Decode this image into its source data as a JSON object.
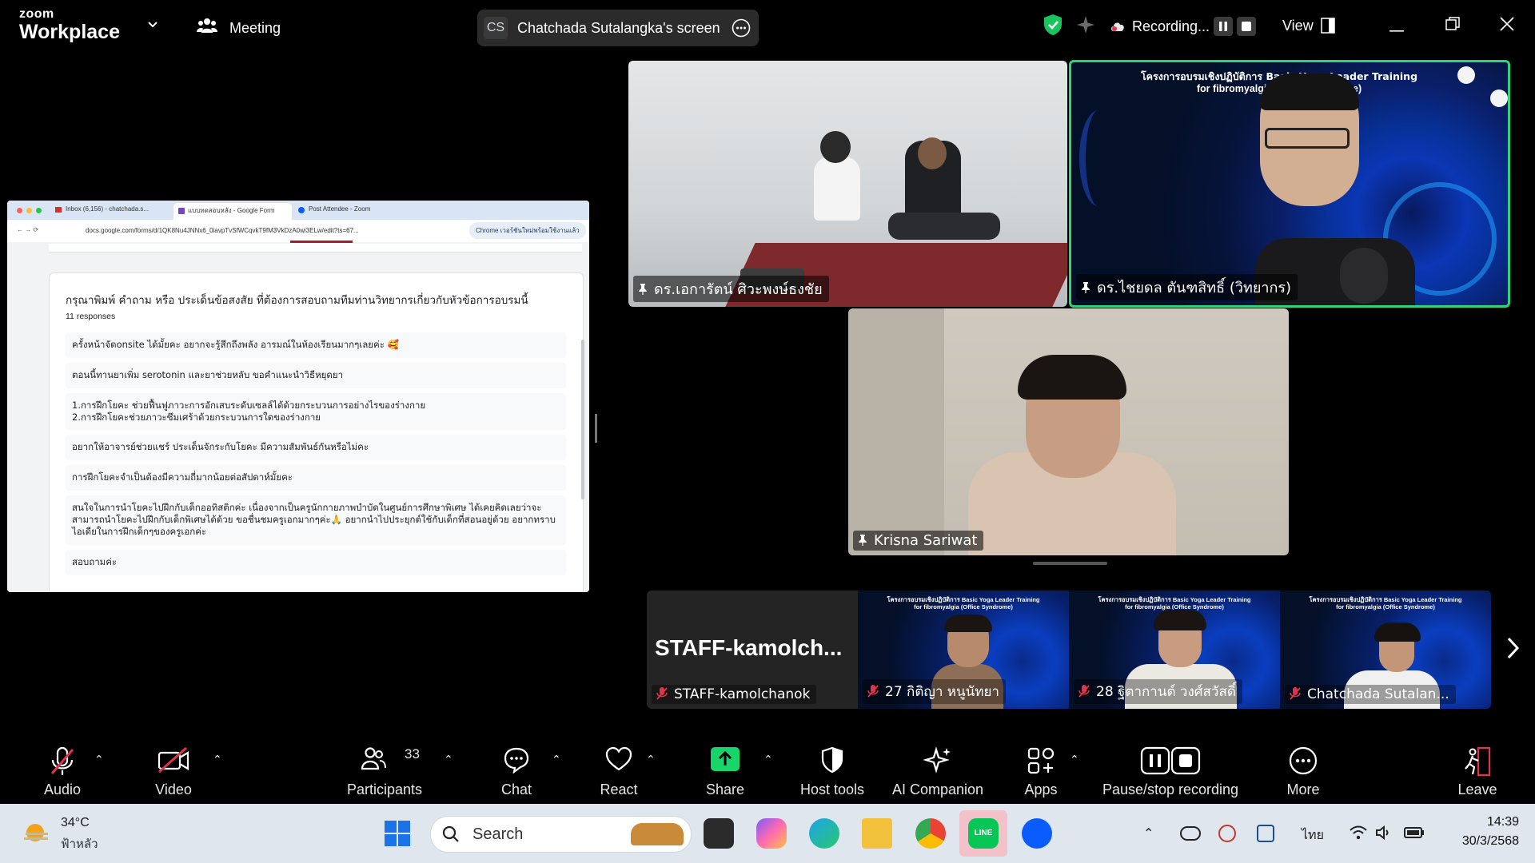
{
  "topbar": {
    "logo_small": "zoom",
    "logo_big": "Workplace",
    "meeting_label": "Meeting",
    "share_badge": "CS",
    "share_title": "Chatchada Sutalangka's screen",
    "recording_label": "Recording...",
    "view_label": "View"
  },
  "shared_screen": {
    "tabs": [
      "Inbox (6,156) - chatchada.s...",
      "แบบทดสอบหลัง - Google Form",
      "Post Attendee - Zoom"
    ],
    "url": "docs.google.com/forms/d/1QK8Nu4JNNx6_0iavpTvSfWCqvkT9fM3VkDzA0wi3ELw/edit?ts=67...",
    "chrome_update": "Chrome เวอร์ชันใหม่พร้อมใช้งานแล้ว",
    "question": "กรุณาพิมพ์ คำถาม หรือ ประเด็นข้อสงสัย ที่ต้องการสอบถามทีมท่านวิทยากรเกี่ยวกับหัวข้อการอบรมนี้",
    "response_count": "11 responses",
    "responses": [
      "ครั้งหน้าจัดonsite ได้มั้ยคะ อยากจะรู้สึกถึงพลัง อารมณ์ในห้องเรียนมากๆเลยค่ะ 🥰",
      "ตอนนี้ทานยาเพิ่ม serotonin และยาช่วยหลับ ขอคำแนะนำวิธีหยุดยา",
      "1.การฝึกโยคะ ช่วยฟื้นฟูภาวะการอักเสบระดับเซลล์ได้ด้วยกระบวนการอย่างไรของร่างกาย\n2.การฝึกโยคะช่วยภาวะซึมเศร้าด้วยกระบวนการใดของร่างกาย",
      "อยากให้อาจารย์ช่วยแชร์ ประเด็นจักระกับโยคะ มีความสัมพันธ์กันหรือไม่คะ",
      "การฝึกโยคะจำเป็นต้องมีความถี่มากน้อยต่อสัปดาห์มั้ยคะ",
      "สนใจในการนำโยคะไปฝึกกับเด็กออทิสติกค่ะ เนื่องจากเป็นครูนักกายภาพบำบัดในศูนย์การศึกษาพิเศษ ได้เคยคิดเลยว่าจะสามารถนำโยคะไปฝึกกับเด็กพิเศษได้ด้วย ขอชื่นชมครูเอกมากๆค่ะ🙏 อยากนำไปประยุกต์ใช้กับเด็กที่สอนอยู่ด้วย อยากทราบไอเดียในการฝึกเด็กๆของครูเอกค่ะ",
      "สอบถามค่ะ"
    ]
  },
  "videos": {
    "main_left": "ดร.เอการัตน์ ศิวะพงษ์ธงชัย",
    "main_right": "ดร.ไชยดล ตันฑสิทธิ์ (วิทยากร)",
    "main_right_banner_1": "โครงการอบรมเชิงปฏิบัติการ Basic Yoga Leader Training",
    "main_right_banner_2": "for fibromyalgia (Office Syndrome)",
    "center": "Krisna Sariwat"
  },
  "gallery": {
    "staff_big": "STAFF-kamolch...",
    "tiles": [
      "STAFF-kamolchanok",
      "27 กิติญา หนูนัทยา",
      "28 ฐิตากานต์ วงศ์สวัสดิ์",
      "Chatchada Sutalan..."
    ],
    "banner_1": "โครงการอบรมเชิงปฏิบัติการ Basic Yoga Leader Training",
    "banner_2": "for fibromyalgia (Office Syndrome)"
  },
  "toolbar": {
    "audio": "Audio",
    "video": "Video",
    "participants": "Participants",
    "participants_count": "33",
    "chat": "Chat",
    "react": "React",
    "share": "Share",
    "host_tools": "Host tools",
    "ai_companion": "AI Companion",
    "apps": "Apps",
    "pause_stop": "Pause/stop recording",
    "more": "More",
    "leave": "Leave"
  },
  "taskbar": {
    "temperature": "34°C",
    "weather": "ฟ้าหลัว",
    "search": "Search",
    "language": "ไทย",
    "time": "14:39",
    "date": "30/3/2568"
  },
  "colors": {
    "share_green": "#19d36b",
    "active_speaker": "#2fd47a",
    "muted_red": "#e0344a",
    "leave_red": "#e0344a"
  }
}
